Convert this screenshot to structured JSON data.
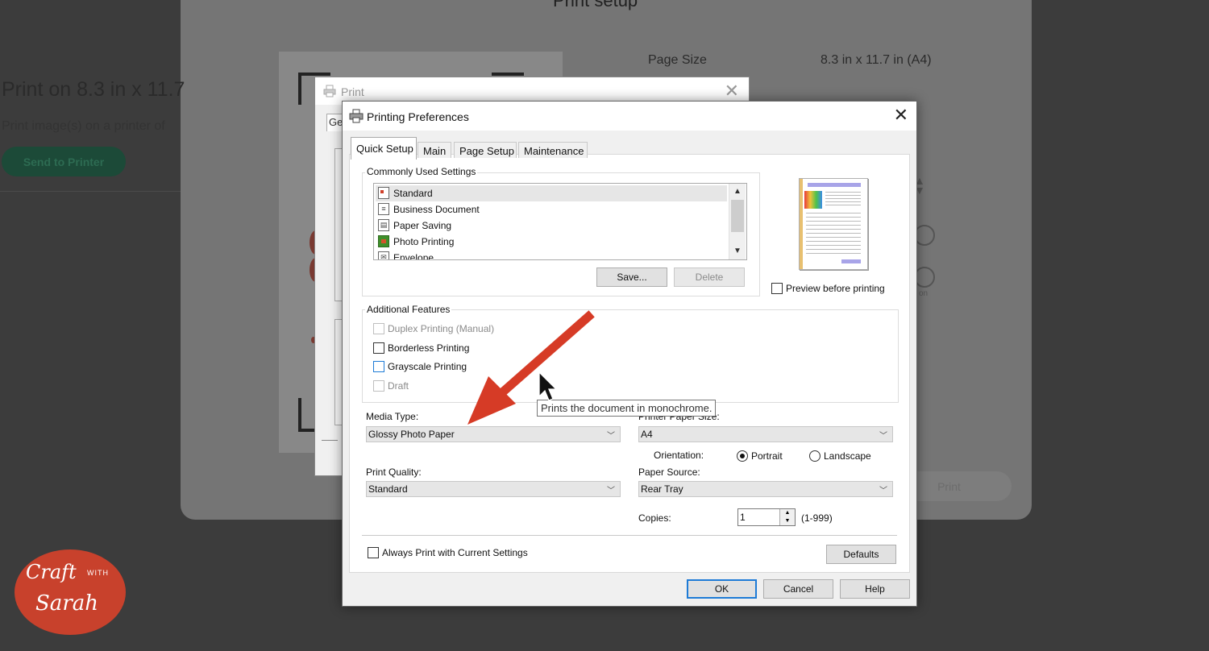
{
  "background_app": {
    "title": "Print setup",
    "left_heading": "Print on 8.3 in x 11.7",
    "left_subtext": "Print image(s) on a printer of",
    "send_button": "Send to Printer",
    "page_size_label": "Page Size",
    "page_size_value": "8.3 in x 11.7 in (A4)",
    "print_button": "Print",
    "partial_text": "on"
  },
  "print_dialog": {
    "title": "Print",
    "tab_partial": "Ge"
  },
  "preferences": {
    "title": "Printing Preferences",
    "tabs": [
      {
        "label": "Quick Setup"
      },
      {
        "label": "Main"
      },
      {
        "label": "Page Setup"
      },
      {
        "label": "Maintenance"
      }
    ],
    "commonly_used": {
      "label": "Commonly Used Settings",
      "items": [
        {
          "label": "Standard"
        },
        {
          "label": "Business Document"
        },
        {
          "label": "Paper Saving"
        },
        {
          "label": "Photo Printing"
        },
        {
          "label": "Envelope"
        }
      ],
      "save_button": "Save...",
      "delete_button": "Delete"
    },
    "preview_checkbox": "Preview before printing",
    "additional_features": {
      "label": "Additional Features",
      "items": [
        {
          "label": "Duplex Printing (Manual)",
          "enabled": false,
          "checked": false
        },
        {
          "label": "Borderless Printing",
          "enabled": true,
          "checked": false
        },
        {
          "label": "Grayscale Printing",
          "enabled": true,
          "checked": false
        },
        {
          "label": "Draft",
          "enabled": false,
          "checked": false
        }
      ]
    },
    "media_type": {
      "label": "Media Type:",
      "value": "Glossy Photo Paper"
    },
    "printer_paper_size": {
      "label": "Printer Paper Size:",
      "value": "A4"
    },
    "orientation": {
      "label": "Orientation:",
      "portrait": "Portrait",
      "landscape": "Landscape",
      "selected": "Portrait"
    },
    "print_quality": {
      "label": "Print Quality:",
      "value": "Standard"
    },
    "paper_source": {
      "label": "Paper Source:",
      "value": "Rear Tray"
    },
    "copies": {
      "label": "Copies:",
      "value": "1",
      "range": "(1-999)"
    },
    "always_print_checkbox": "Always Print with Current Settings",
    "defaults_button": "Defaults",
    "ok_button": "OK",
    "cancel_button": "Cancel",
    "help_button": "Help"
  },
  "tooltip": "Prints the document in monochrome.",
  "annotation_arrow_color": "#d63b26",
  "logo": {
    "line1": "Craft",
    "line2": "WITH",
    "line3": "Sarah",
    "color": "#c8412c"
  }
}
